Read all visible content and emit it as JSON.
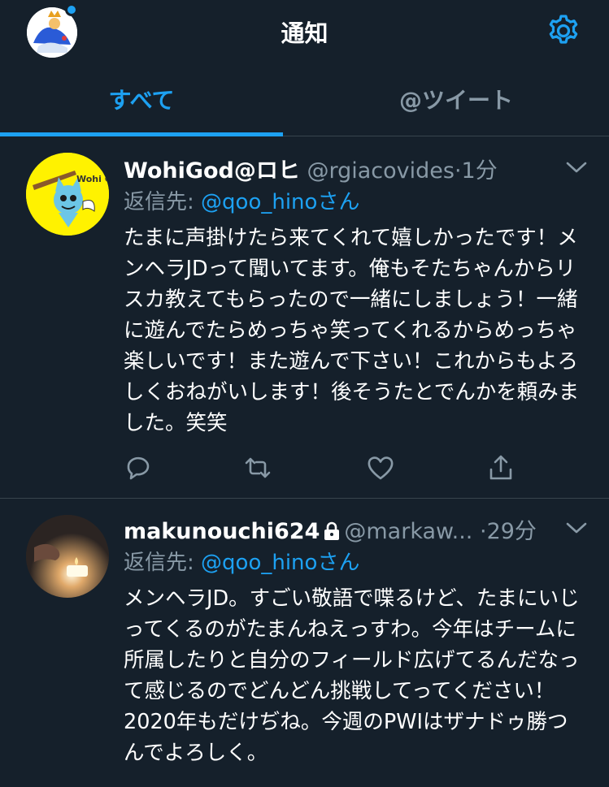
{
  "header": {
    "title": "通知",
    "avatar_icon": "user-avatar",
    "settings_icon": "gear-icon"
  },
  "tabs": [
    {
      "label": "すべて",
      "active": true
    },
    {
      "label": "@ツイート",
      "active": false
    }
  ],
  "tweets": [
    {
      "name": "WohiGod@ロヒ",
      "handle": "@rgiacovides",
      "time": "·1分",
      "reply_prefix": "返信先: ",
      "reply_to": "@qoo_hino",
      "reply_suffix": "さん",
      "body": "たまに声掛けたら来てくれて嬉しかったです！メンヘラJDって聞いてます。俺もそたちゃんからリスカ教えてもらったので一緒にしましょう！一緒に遊んでたらめっちゃ笑ってくれるからめっちゃ楽しいです！また遊んで下さい！これからもよろしくおねがいします！後そうたとでんかを頼みました。笑笑",
      "avatar_text": "Wohi God"
    },
    {
      "name": "makunouchi624",
      "locked": true,
      "handle": "@markaw...",
      "time": "·29分",
      "reply_prefix": "返信先: ",
      "reply_to": "@qoo_hino",
      "reply_suffix": "さん",
      "body": "メンヘラJD。すごい敬語で喋るけど、たまにいじってくるのがたまんねえっすわ。今年はチームに所属したりと自分のフィールド広げてるんだなって感じるのでどんどん挑戦してってください！2020年もだけぢね。今週のPWIはザナドゥ勝つんでよろしく。"
    }
  ],
  "colors": {
    "background": "#15202b",
    "accent": "#1da1f2",
    "muted": "#8899a6",
    "divider": "#38444d"
  }
}
